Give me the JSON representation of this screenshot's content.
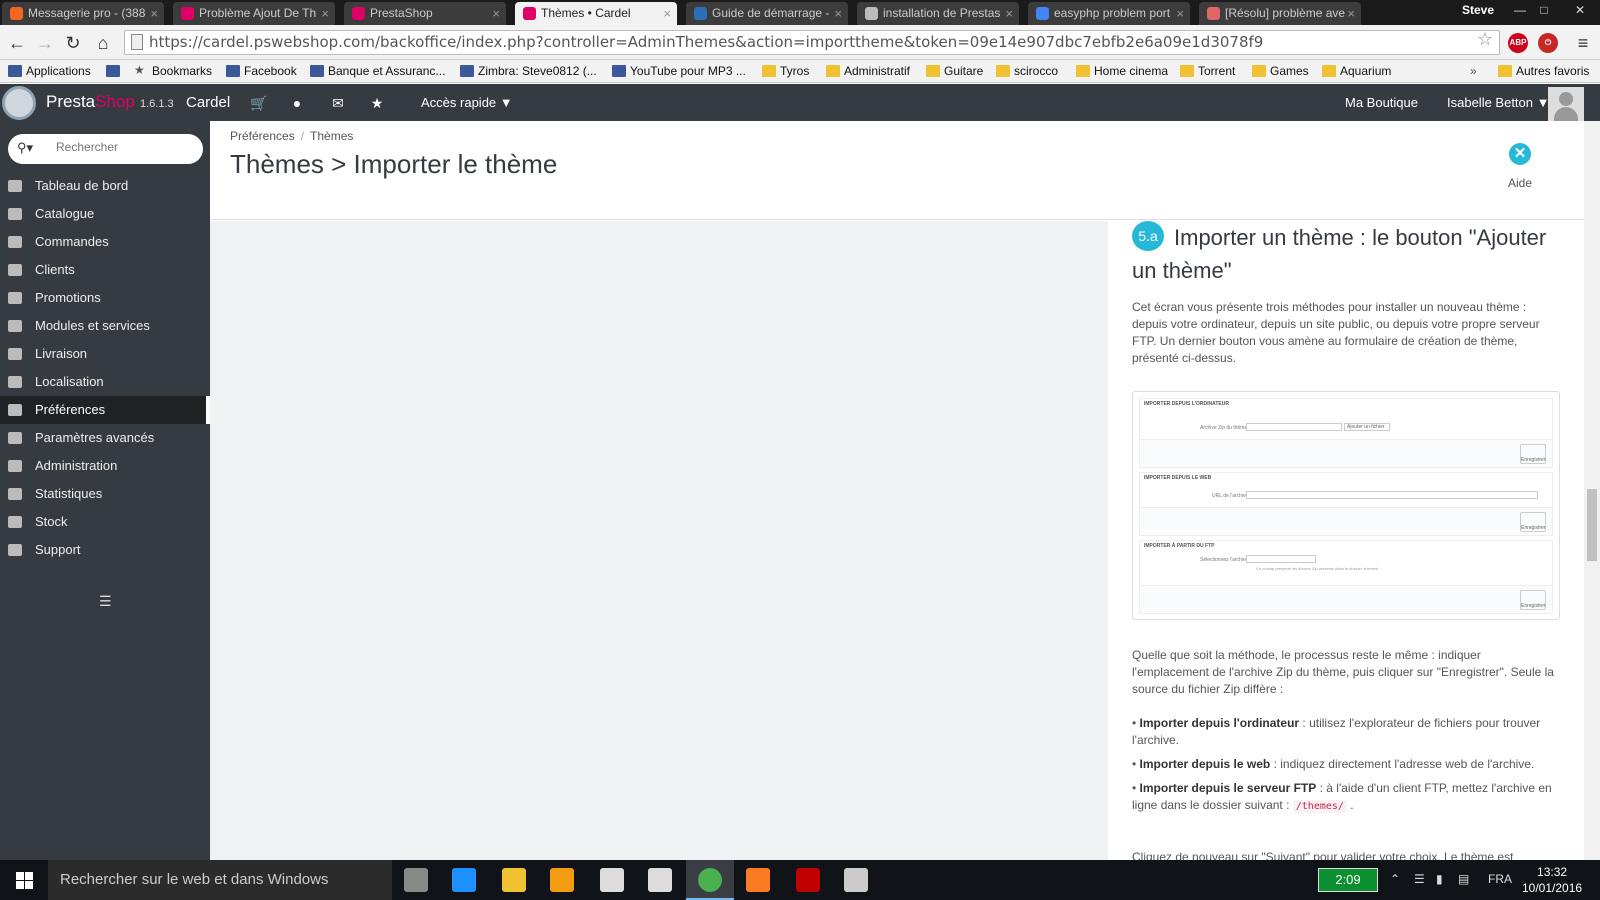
{
  "browser": {
    "tabs": [
      {
        "title": "Messagerie pro - (388",
        "favicon_color": "#f26522"
      },
      {
        "title": "Problème Ajout De Th",
        "favicon_color": "#df0067"
      },
      {
        "title": "PrestaShop",
        "favicon_color": "#df0067"
      },
      {
        "title": "Thèmes • Cardel",
        "favicon_color": "#df0067"
      },
      {
        "title": "Guide de démarrage -",
        "favicon_color": "#2a6fb7"
      },
      {
        "title": "installation de Prestas",
        "favicon_color": "#bbbbbb"
      },
      {
        "title": "easyphp problem port",
        "favicon_color": "#4285f4"
      },
      {
        "title": "[Résolu] problème ave",
        "favicon_color": "#e06666"
      }
    ],
    "active_tab_index": 3,
    "profile_name": "Steve",
    "url": "https://cardel.pswebshop.com/backoffice/index.php?controller=AdminThemes&action=importtheme&token=09e14e907dbc7ebfb2e6a09e1d3078f9",
    "extensions": [
      "ABP"
    ],
    "bookmarks": [
      {
        "label": "Applications",
        "type": "site"
      },
      {
        "label": "",
        "type": "site"
      },
      {
        "label": "Bookmarks",
        "type": "star"
      },
      {
        "label": "Facebook",
        "type": "site"
      },
      {
        "label": "Banque et Assuranc...",
        "type": "site"
      },
      {
        "label": "Zimbra: Steve0812 (...",
        "type": "site"
      },
      {
        "label": "YouTube pour MP3 ...",
        "type": "site"
      },
      {
        "label": "Tyros",
        "type": "folder"
      },
      {
        "label": "Administratif",
        "type": "folder"
      },
      {
        "label": "Guitare",
        "type": "folder"
      },
      {
        "label": "scirocco",
        "type": "folder"
      },
      {
        "label": "Home cinema",
        "type": "folder"
      },
      {
        "label": "Torrent",
        "type": "folder"
      },
      {
        "label": "Games",
        "type": "folder"
      },
      {
        "label": "Aquarium",
        "type": "folder"
      }
    ],
    "bookmarks_overflow": "»",
    "other_bookmarks": "Autres favoris"
  },
  "header": {
    "logo_presta": "Presta",
    "logo_shop": "Shop",
    "version": "1.6.1.3",
    "shop_name": "Cardel",
    "icons": [
      "cart-icon",
      "user-icon",
      "envelope-icon",
      "trophy-icon"
    ],
    "quick_access": "Accès rapide",
    "my_shop": "Ma Boutique",
    "user_name": "Isabelle Betton"
  },
  "sidebar": {
    "search_placeholder": "Rechercher",
    "items": [
      {
        "label": "Tableau de bord",
        "active": false
      },
      {
        "label": "Catalogue",
        "active": false
      },
      {
        "label": "Commandes",
        "active": false
      },
      {
        "label": "Clients",
        "active": false
      },
      {
        "label": "Promotions",
        "active": false
      },
      {
        "label": "Modules et services",
        "active": false
      },
      {
        "label": "Livraison",
        "active": false
      },
      {
        "label": "Localisation",
        "active": false
      },
      {
        "label": "Préférences",
        "active": true
      },
      {
        "label": "Paramètres avancés",
        "active": false
      },
      {
        "label": "Administration",
        "active": false
      },
      {
        "label": "Statistiques",
        "active": false
      },
      {
        "label": "Stock",
        "active": false
      },
      {
        "label": "Support",
        "active": false
      }
    ]
  },
  "page": {
    "breadcrumb": [
      "Préférences",
      "Thèmes"
    ],
    "breadcrumb_sep": "/",
    "title": "Thèmes > Importer le thème",
    "help_label": "Aide"
  },
  "help_panel": {
    "step": "5.a",
    "title": "Importer un thème : le bouton \"Ajouter un thème\"",
    "intro": "Cet écran vous présente trois méthodes pour installer un nouveau thème : depuis votre ordinateur, depuis un site public, ou depuis votre propre serveur FTP. Un dernier bouton vous amène au formulaire de création de thème, présenté ci-dessus.",
    "screenshot": {
      "sections": [
        {
          "heading": "IMPORTER DEPUIS L'ORDINATEUR",
          "label": "Archive Zip du thème",
          "button": "Ajouter un fichier",
          "save": "Enregistrer"
        },
        {
          "heading": "IMPORTER DEPUIS LE WEB",
          "label": "URL de l'archive",
          "save": "Enregistrer"
        },
        {
          "heading": "IMPORTER À PARTIR DU FTP",
          "label": "Sélectionnez l'archive",
          "hint": "Ce champ présente les fichiers Zip présents dans le dossier /themes/",
          "save": "Enregistrer"
        }
      ]
    },
    "para2": "Quelle que soit la méthode, le processus reste le même : indiquer l'emplacement de l'archive Zip du thème, puis cliquer sur \"Enregistrer\". Seule la source du fichier Zip diffère :",
    "bullets": [
      {
        "bold": "Importer depuis l'ordinateur",
        "text": " : utilisez l'explorateur de fichiers pour trouver l'archive."
      },
      {
        "bold": "Importer depuis le web",
        "text": " : indiquez directement l'adresse web de l'archive."
      },
      {
        "bold": "Importer depuis le serveur FTP",
        "text": " : à l'aide d'un client FTP, mettez l'archive en ligne dans le dossier suivant : ",
        "code": "/themes/",
        "after": " ."
      }
    ],
    "para3": "Cliquez de nouveau sur \"Suivant\" pour valider votre choix. Le thème est"
  },
  "taskbar": {
    "search_placeholder": "Rechercher sur le web et dans Windows",
    "apps": [
      {
        "name": "task-view",
        "color": "#888888"
      },
      {
        "name": "edge",
        "color": "#1e90ff"
      },
      {
        "name": "file-explorer",
        "color": "#f0c232"
      },
      {
        "name": "media-player",
        "color": "#f39c12"
      },
      {
        "name": "calculator",
        "color": "#dddddd"
      },
      {
        "name": "store",
        "color": "#dddddd"
      },
      {
        "name": "chrome",
        "color": "#4caf50"
      },
      {
        "name": "xampp",
        "color": "#fb7a24"
      },
      {
        "name": "filezilla",
        "color": "#bf0000"
      },
      {
        "name": "settings",
        "color": "#cccccc"
      }
    ],
    "battery_time": "2:09",
    "language": "FRA",
    "time": "13:32",
    "date": "10/01/2016"
  }
}
